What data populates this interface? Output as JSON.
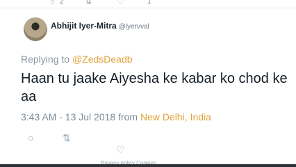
{
  "previous_tweet": {
    "reply_count": "2",
    "like_count": "1"
  },
  "tweet": {
    "author_name": "Abhijit Iyer-Mitra",
    "author_handle": "@lyervval",
    "replying_prefix": "Replying to",
    "replying_mention": "@ZedsDeadb",
    "text": "Haan tu jaake Aiyesha ke kabar ko chod ke aa",
    "timestamp": "3:43 AM - 13 Jul 2018 from",
    "location": "New Delhi, India"
  },
  "footer": {
    "links": "Privacy policy   Cookies"
  },
  "colors": {
    "accent": "#e2a23b",
    "muted": "#8a97a3",
    "text": "#141d26"
  }
}
